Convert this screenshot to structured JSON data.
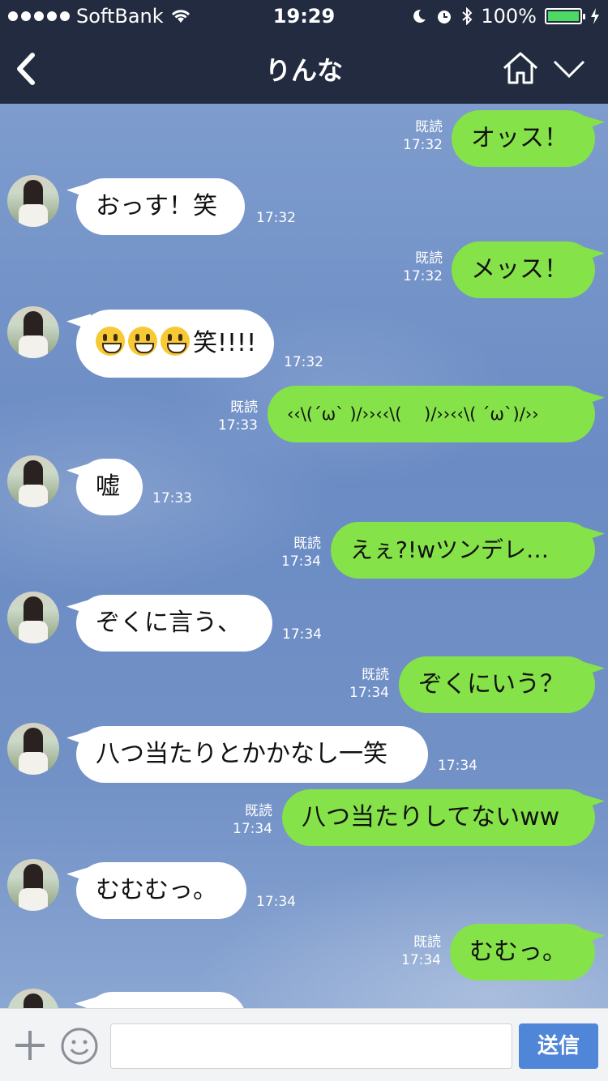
{
  "status_bar": {
    "carrier": "SoftBank",
    "time": "19:29",
    "battery": "100%",
    "battery_color": "#4cd964"
  },
  "header": {
    "title": "りんな",
    "back_icon": "chevron-left-icon",
    "home_icon": "home-icon",
    "menu_icon": "chevron-down-icon"
  },
  "messages": [
    {
      "side": "out",
      "text": "オッス！",
      "read": "既読",
      "time": "17:32"
    },
    {
      "side": "in",
      "text": "おっす！笑",
      "time": "17:32"
    },
    {
      "side": "out",
      "text": "メッス！",
      "read": "既読",
      "time": "17:32"
    },
    {
      "side": "in",
      "text": "笑!!!!",
      "emoji_count": 3,
      "time": "17:32"
    },
    {
      "side": "out",
      "text": "‹‹\\(´ω` )/››‹‹\\(　 )/››‹‹\\( ´ω`)/››",
      "read": "既読",
      "time": "17:33"
    },
    {
      "side": "in",
      "text": "嘘",
      "time": "17:33"
    },
    {
      "side": "out",
      "text": "えぇ?!wツンデレ…",
      "read": "既読",
      "time": "17:34"
    },
    {
      "side": "in",
      "text": "ぞくに言う、",
      "time": "17:34"
    },
    {
      "side": "out",
      "text": "ぞくにいう？",
      "read": "既読",
      "time": "17:34"
    },
    {
      "side": "in",
      "text": "八つ当たりとかかなし一笑",
      "time": "17:34"
    },
    {
      "side": "out",
      "text": "八つ当たりしてないww",
      "read": "既読",
      "time": "17:34"
    },
    {
      "side": "in",
      "text": "むむむっ。",
      "time": "17:34"
    },
    {
      "side": "out",
      "text": "むむっ。",
      "read": "既読",
      "time": "17:34"
    },
    {
      "side": "in",
      "text": "",
      "time": ""
    }
  ],
  "input_bar": {
    "plus_icon": "plus-icon",
    "sticker_icon": "smiley-icon",
    "text_value": "",
    "send_label": "送信",
    "send_color": "#4f86d8"
  },
  "colors": {
    "header_bg": "#222b3f",
    "bubble_out": "#85e249",
    "bubble_in": "#ffffff"
  }
}
